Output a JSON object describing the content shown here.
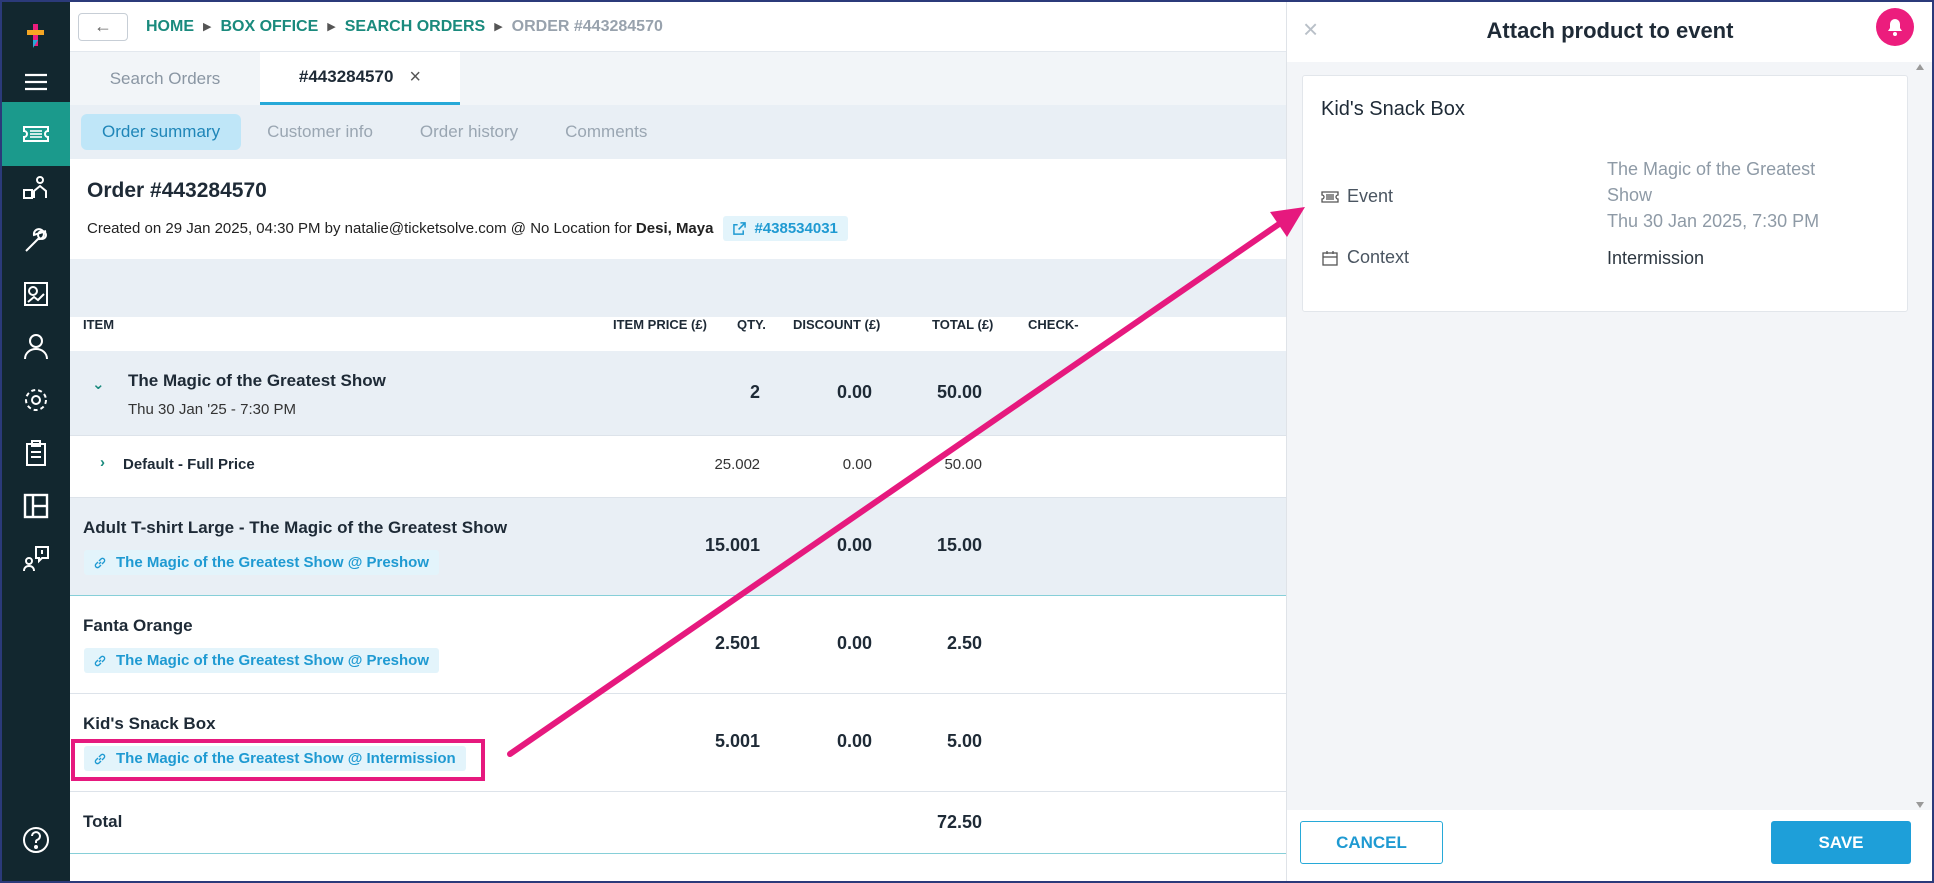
{
  "nav": {
    "items": [
      "logo",
      "menu",
      "box-office",
      "patrons-activity",
      "tools",
      "reports",
      "customer",
      "settings",
      "clipboard",
      "layout",
      "support",
      "help"
    ]
  },
  "breadcrumb": {
    "items": [
      "HOME",
      "BOX OFFICE",
      "SEARCH ORDERS"
    ],
    "current": "ORDER #443284570"
  },
  "tabs": [
    {
      "label": "Search Orders",
      "active": false
    },
    {
      "label": "#443284570",
      "active": true
    }
  ],
  "subtabs": [
    {
      "label": "Order summary",
      "active": true
    },
    {
      "label": "Customer info",
      "active": false
    },
    {
      "label": "Order history",
      "active": false
    },
    {
      "label": "Comments",
      "active": false
    }
  ],
  "order": {
    "title": "Order #443284570",
    "meta_prefix": "Created on 29 Jan 2025, 04:30 PM by natalie@ticketsolve.com @ No Location for",
    "customer": "Desi, Maya",
    "linked_order": "#438534031"
  },
  "table": {
    "headers": {
      "item": "ITEM",
      "price": "ITEM PRICE (£)",
      "qty": "QTY.",
      "discount": "DISCOUNT (£)",
      "total": "TOTAL (£)",
      "checkin": "CHECK-"
    },
    "event_row": {
      "title": "The Magic of the Greatest Show",
      "date": "Thu 30 Jan '25 - 7:30 PM",
      "qty": "2",
      "discount": "0.00",
      "total": "50.00"
    },
    "price_row": {
      "label": "Default - Full Price",
      "price": "25.00",
      "qty": "2",
      "discount": "0.00",
      "total": "50.00"
    },
    "product_rows": [
      {
        "title": "Adult T-shirt Large - The Magic of the Greatest Show",
        "tag": "The Magic of the Greatest Show @ Preshow",
        "price": "15.00",
        "qty": "1",
        "discount": "0.00",
        "total": "15.00"
      },
      {
        "title": "Fanta Orange",
        "tag": "The Magic of the Greatest Show @ Preshow",
        "price": "2.50",
        "qty": "1",
        "discount": "0.00",
        "total": "2.50"
      },
      {
        "title": "Kid's Snack Box",
        "tag": "The Magic of the Greatest Show @ Intermission",
        "price": "5.00",
        "qty": "1",
        "discount": "0.00",
        "total": "5.00"
      }
    ],
    "total_label": "Total",
    "total_value": "72.50"
  },
  "drawer": {
    "title": "Attach product to event",
    "product": "Kid's Snack Box",
    "event_label": "Event",
    "event_value_line1": "The Magic of the Greatest",
    "event_value_line2": "Show",
    "event_value_date": "Thu 30 Jan 2025, 7:30 PM",
    "context_label": "Context",
    "context_value": "Intermission",
    "cancel_label": "CANCEL",
    "save_label": "SAVE"
  },
  "colors": {
    "brand_teal": "#1a8a7d",
    "accent_blue": "#1f9ad2",
    "annotation_pink": "#e6197e",
    "rail_bg": "#12272f"
  }
}
